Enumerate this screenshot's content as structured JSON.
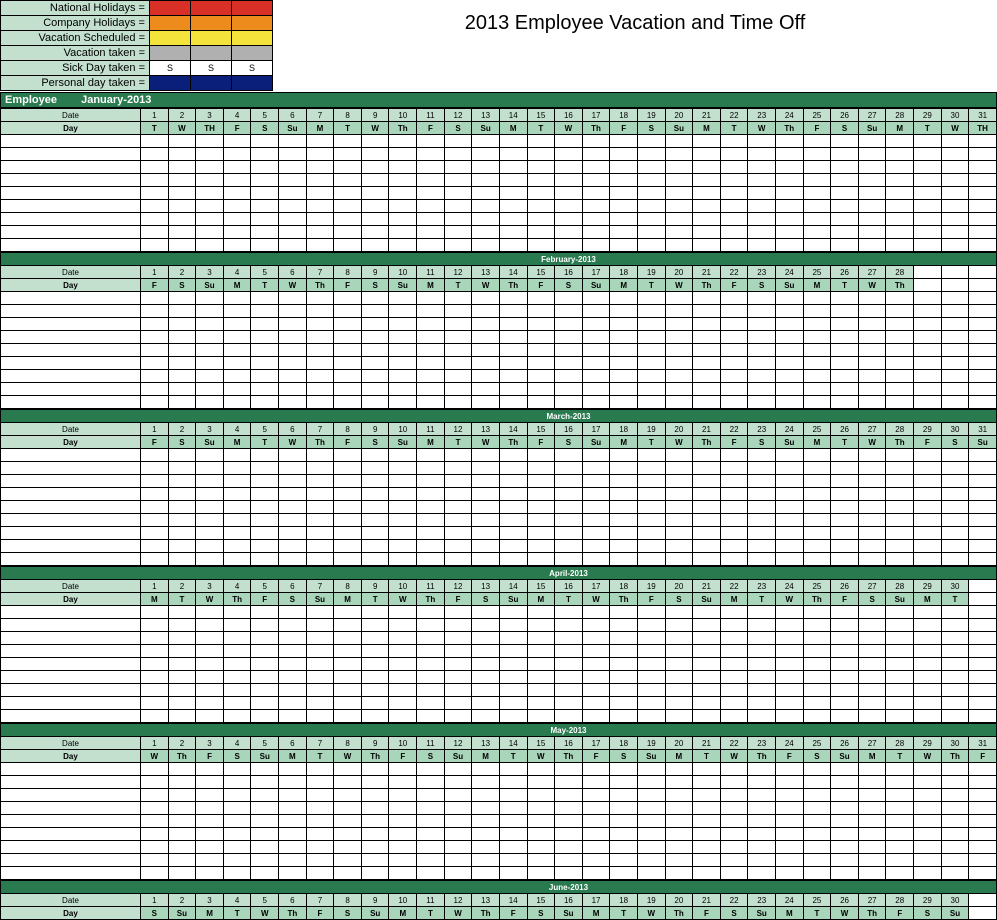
{
  "title": "2013 Employee Vacation and Time Off",
  "legend": [
    {
      "label": "National Holidays =",
      "colors": [
        "#d83027",
        "#d83027",
        "#d83027"
      ],
      "text": [
        "",
        "",
        ""
      ]
    },
    {
      "label": "Company Holidays =",
      "colors": [
        "#ed8b1c",
        "#ed8b1c",
        "#ed8b1c"
      ],
      "text": [
        "",
        "",
        ""
      ]
    },
    {
      "label": "Vacation Scheduled =",
      "colors": [
        "#f4e33a",
        "#f4e33a",
        "#f4e33a"
      ],
      "text": [
        "",
        "",
        ""
      ]
    },
    {
      "label": "Vacation taken =",
      "colors": [
        "#b0b0b0",
        "#b0b0b0",
        "#b0b0b0"
      ],
      "text": [
        "",
        "",
        ""
      ]
    },
    {
      "label": "Sick Day taken =",
      "colors": [
        "#ffffff",
        "#ffffff",
        "#ffffff"
      ],
      "text": [
        "S",
        "S",
        "S"
      ]
    },
    {
      "label": "Personal day taken =",
      "colors": [
        "#0a1f7a",
        "#0a1f7a",
        "#0a1f7a"
      ],
      "text": [
        "",
        "",
        ""
      ]
    }
  ],
  "employeeHeader": "Employee",
  "dateLabel": "Date",
  "dayLabel": "Day",
  "months": [
    {
      "name": "January-2013",
      "days": 31,
      "dates": [
        1,
        2,
        3,
        4,
        5,
        6,
        7,
        8,
        9,
        10,
        11,
        12,
        13,
        14,
        15,
        16,
        17,
        18,
        19,
        20,
        21,
        22,
        23,
        24,
        25,
        26,
        27,
        28,
        29,
        30,
        31
      ],
      "dow": [
        "T",
        "W",
        "TH",
        "F",
        "S",
        "Su",
        "M",
        "T",
        "W",
        "Th",
        "F",
        "S",
        "Su",
        "M",
        "T",
        "W",
        "Th",
        "F",
        "S",
        "Su",
        "M",
        "T",
        "W",
        "Th",
        "F",
        "S",
        "Su",
        "M",
        "T",
        "W",
        "TH"
      ],
      "rows": 9
    },
    {
      "name": "February-2013",
      "days": 28,
      "dates": [
        1,
        2,
        3,
        4,
        5,
        6,
        7,
        8,
        9,
        10,
        11,
        12,
        13,
        14,
        15,
        16,
        17,
        18,
        19,
        20,
        21,
        22,
        23,
        24,
        25,
        26,
        27,
        28
      ],
      "dow": [
        "F",
        "S",
        "Su",
        "M",
        "T",
        "W",
        "Th",
        "F",
        "S",
        "Su",
        "M",
        "T",
        "W",
        "Th",
        "F",
        "S",
        "Su",
        "M",
        "T",
        "W",
        "Th",
        "F",
        "S",
        "Su",
        "M",
        "T",
        "W",
        "Th"
      ],
      "rows": 9
    },
    {
      "name": "March-2013",
      "days": 31,
      "dates": [
        1,
        2,
        3,
        4,
        5,
        6,
        7,
        8,
        9,
        10,
        11,
        12,
        13,
        14,
        15,
        16,
        17,
        18,
        19,
        20,
        21,
        22,
        23,
        24,
        25,
        26,
        27,
        28,
        29,
        30,
        31
      ],
      "dow": [
        "F",
        "S",
        "Su",
        "M",
        "T",
        "W",
        "Th",
        "F",
        "S",
        "Su",
        "M",
        "T",
        "W",
        "Th",
        "F",
        "S",
        "Su",
        "M",
        "T",
        "W",
        "Th",
        "F",
        "S",
        "Su",
        "M",
        "T",
        "W",
        "Th",
        "F",
        "S",
        "Su"
      ],
      "rows": 9
    },
    {
      "name": "April-2013",
      "days": 30,
      "dates": [
        1,
        2,
        3,
        4,
        5,
        6,
        7,
        8,
        9,
        10,
        11,
        12,
        13,
        14,
        15,
        16,
        17,
        18,
        19,
        20,
        21,
        22,
        23,
        24,
        25,
        26,
        27,
        28,
        29,
        30
      ],
      "dow": [
        "M",
        "T",
        "W",
        "Th",
        "F",
        "S",
        "Su",
        "M",
        "T",
        "W",
        "Th",
        "F",
        "S",
        "Su",
        "M",
        "T",
        "W",
        "Th",
        "F",
        "S",
        "Su",
        "M",
        "T",
        "W",
        "Th",
        "F",
        "S",
        "Su",
        "M",
        "T"
      ],
      "rows": 9
    },
    {
      "name": "May-2013",
      "days": 31,
      "dates": [
        1,
        2,
        3,
        4,
        5,
        6,
        7,
        8,
        9,
        10,
        11,
        12,
        13,
        14,
        15,
        16,
        17,
        18,
        19,
        20,
        21,
        22,
        23,
        24,
        25,
        26,
        27,
        28,
        29,
        30,
        31
      ],
      "dow": [
        "W",
        "Th",
        "F",
        "S",
        "Su",
        "M",
        "T",
        "W",
        "Th",
        "F",
        "S",
        "Su",
        "M",
        "T",
        "W",
        "Th",
        "F",
        "S",
        "Su",
        "M",
        "T",
        "W",
        "Th",
        "F",
        "S",
        "Su",
        "M",
        "T",
        "W",
        "Th",
        "F"
      ],
      "rows": 9
    },
    {
      "name": "June-2013",
      "days": 30,
      "dates": [
        1,
        2,
        3,
        4,
        5,
        6,
        7,
        8,
        9,
        10,
        11,
        12,
        13,
        14,
        15,
        16,
        17,
        18,
        19,
        20,
        21,
        22,
        23,
        24,
        25,
        26,
        27,
        28,
        29,
        30
      ],
      "dow": [
        "S",
        "Su",
        "M",
        "T",
        "W",
        "Th",
        "F",
        "S",
        "Su",
        "M",
        "T",
        "W",
        "Th",
        "F",
        "S",
        "Su",
        "M",
        "T",
        "W",
        "Th",
        "F",
        "S",
        "Su",
        "M",
        "T",
        "W",
        "Th",
        "F",
        "S",
        "Su"
      ],
      "rows": 0
    }
  ],
  "maxCols": 31
}
